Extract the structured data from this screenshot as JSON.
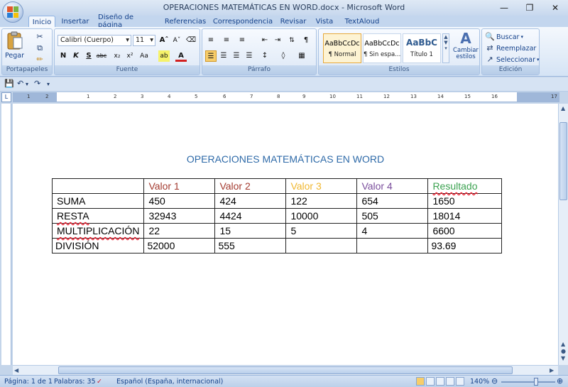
{
  "window": {
    "title": "OPERACIONES MATEMÁTICAS EN WORD.docx - Microsoft Word",
    "controls": [
      "minimize-icon",
      "restore-icon",
      "close-icon"
    ]
  },
  "tabs": [
    {
      "label": "Inicio",
      "active": true
    },
    {
      "label": "Insertar"
    },
    {
      "label": "Diseño de página"
    },
    {
      "label": "Referencias"
    },
    {
      "label": "Correspondencia"
    },
    {
      "label": "Revisar"
    },
    {
      "label": "Vista"
    },
    {
      "label": "TextAloud"
    }
  ],
  "ribbon": {
    "clipboard": {
      "paste_label": "Pegar",
      "group_label": "Portapapeles"
    },
    "font": {
      "font_name": "Calibri (Cuerpo)",
      "font_size": "11",
      "group_label": "Fuente"
    },
    "paragraph": {
      "group_label": "Párrafo"
    },
    "styles": {
      "items": [
        {
          "sample": "AaBbCcDc",
          "name": "¶ Normal",
          "selected": true
        },
        {
          "sample": "AaBbCcDc",
          "name": "¶ Sin espa..."
        },
        {
          "sample": "AaBbC",
          "name": "Título 1"
        }
      ],
      "change_label": "Cambiar estilos",
      "group_label": "Estilos"
    },
    "editing": {
      "find": "Buscar",
      "replace": "Reemplazar",
      "select": "Seleccionar",
      "group_label": "Edición"
    }
  },
  "ruler": {
    "numbers": [
      "1",
      "2",
      "1",
      "2",
      "3",
      "4",
      "5",
      "6",
      "7",
      "8",
      "9",
      "10",
      "11",
      "12",
      "13",
      "14",
      "15",
      "16",
      "17"
    ]
  },
  "document": {
    "title": "OPERACIONES MATEMÁTICAS EN WORD",
    "table": {
      "header": [
        "",
        "Valor 1",
        "Valor 2",
        "Valor 3",
        "Valor 4",
        "Resultado"
      ],
      "rows": [
        [
          "SUMA",
          "450",
          "424",
          "122",
          "654",
          "1650"
        ],
        [
          "RESTA",
          "32943",
          "4424",
          "10000",
          "505",
          "18014"
        ],
        [
          "MULTIPLICACIÓN",
          "22",
          "15",
          "5",
          "4",
          "6600"
        ],
        [
          "DIVISIÓN",
          "52000",
          "555",
          "",
          "",
          "93.69"
        ]
      ]
    }
  },
  "status": {
    "page": "Página: 1 de 1",
    "words": "Palabras: 35",
    "language": "Español (España, internacional)",
    "zoom": "140%"
  },
  "colors": {
    "valor1": "#a33a2f",
    "valor2": "#a33a2f",
    "valor3": "#f0b72f",
    "valor4": "#7a4e9c",
    "resultado": "#3ba250",
    "title": "#2e6aa8"
  }
}
